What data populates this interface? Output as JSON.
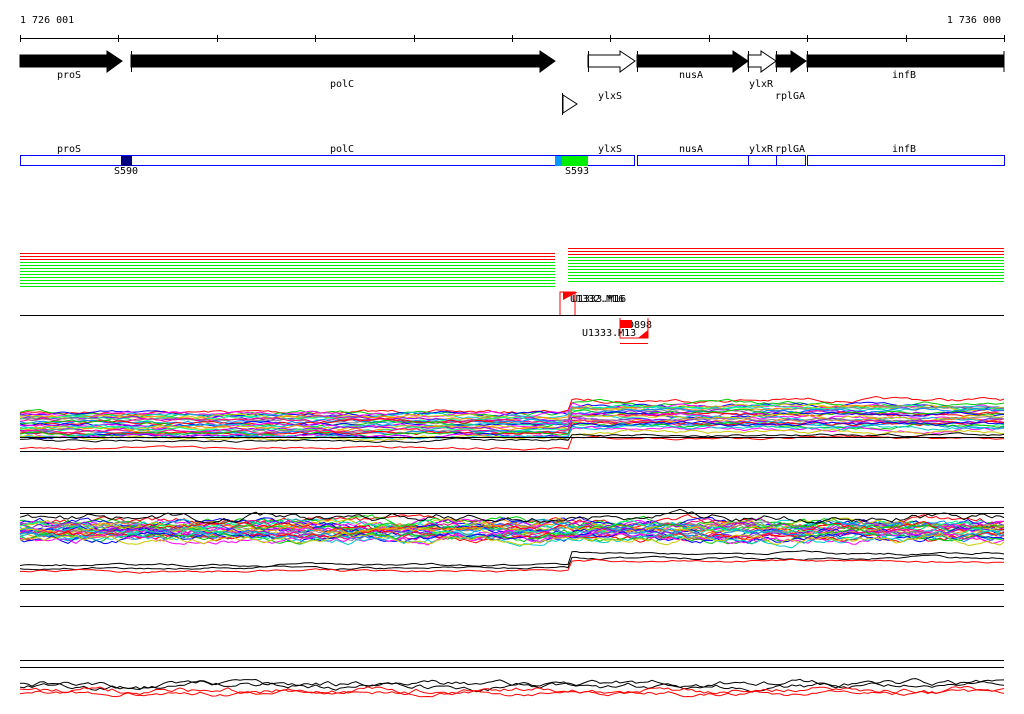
{
  "ruler": {
    "start_label": "1 726 001",
    "end_label": "1 736 000"
  },
  "genes": [
    {
      "name": "proS",
      "strand": "+",
      "filled": true
    },
    {
      "name": "polC",
      "strand": "+",
      "filled": true
    },
    {
      "name": "ylxS",
      "strand": "+",
      "filled": false
    },
    {
      "name": "nusA",
      "strand": "+",
      "filled": true
    },
    {
      "name": "ylxR",
      "strand": "+",
      "filled": false
    },
    {
      "name": "rplGA",
      "strand": "+",
      "filled": true
    },
    {
      "name": "infB",
      "strand": "+",
      "filled": true
    }
  ],
  "segments": {
    "labels": [
      "proS",
      "polC",
      "ylxS",
      "nusA",
      "ylxR",
      "rplGA",
      "infB"
    ],
    "markers": [
      {
        "label": "S590",
        "color": "#000080"
      },
      {
        "label": "S593",
        "color": "#00ee00"
      }
    ],
    "colors": {
      "outline": "#0000ff",
      "light_blue": "#0099ff"
    }
  },
  "features": {
    "labels": [
      "U1333.M16",
      "U1332.M16",
      "D898",
      "U1333.M13"
    ],
    "color": "#ff0000"
  },
  "tracks": {
    "colors": {
      "red": "#ff0000",
      "green": "#00ee00",
      "black": "#000000"
    }
  }
}
